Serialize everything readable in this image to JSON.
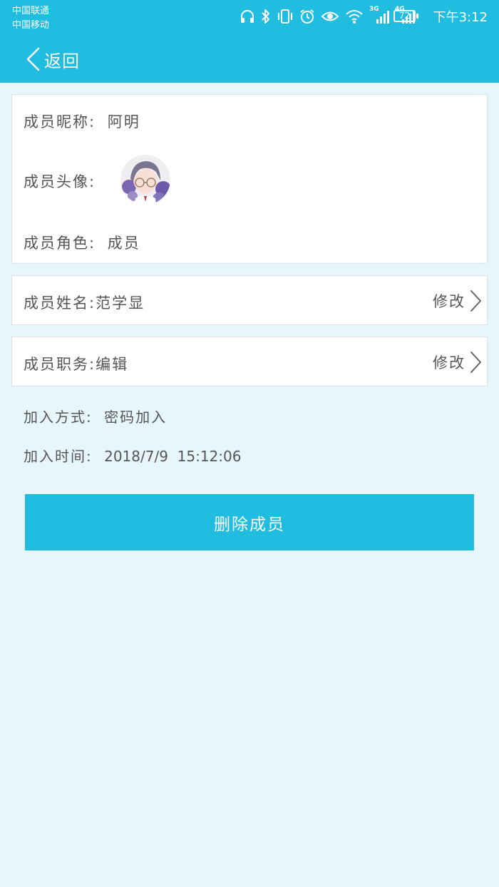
{
  "status_bar": {
    "carrier_1": "中国联通",
    "carrier_2": "中国移动",
    "network_1": "3G",
    "network_2": "4G",
    "battery": "72",
    "time": "下午3:12",
    "icons": [
      "headphones-icon",
      "bluetooth-icon",
      "vibrate-icon",
      "alarm-icon",
      "eye-icon",
      "wifi-icon",
      "signal-3g-icon",
      "signal-4g-icon",
      "battery-icon"
    ]
  },
  "nav": {
    "back_label": "返回",
    "back_icon": "chevron-left-icon"
  },
  "member": {
    "nickname_label": "成员昵称:",
    "nickname": "阿明",
    "avatar_label": "成员头像:",
    "role_label": "成员角色:",
    "role": "成员",
    "name_label": "成员姓名:",
    "name": "范学显",
    "position_label": "成员职务:",
    "position": "编辑",
    "edit_label": "修改",
    "join_method_label": "加入方式:",
    "join_method": "密码加入",
    "join_time_label": "加入时间:",
    "join_time": "2018/7/9  15:12:06"
  },
  "actions": {
    "delete_label": "删除成员"
  },
  "colors": {
    "accent": "#21bde1",
    "background": "#e6f6fc",
    "card": "#ffffff",
    "text": "#555555"
  }
}
